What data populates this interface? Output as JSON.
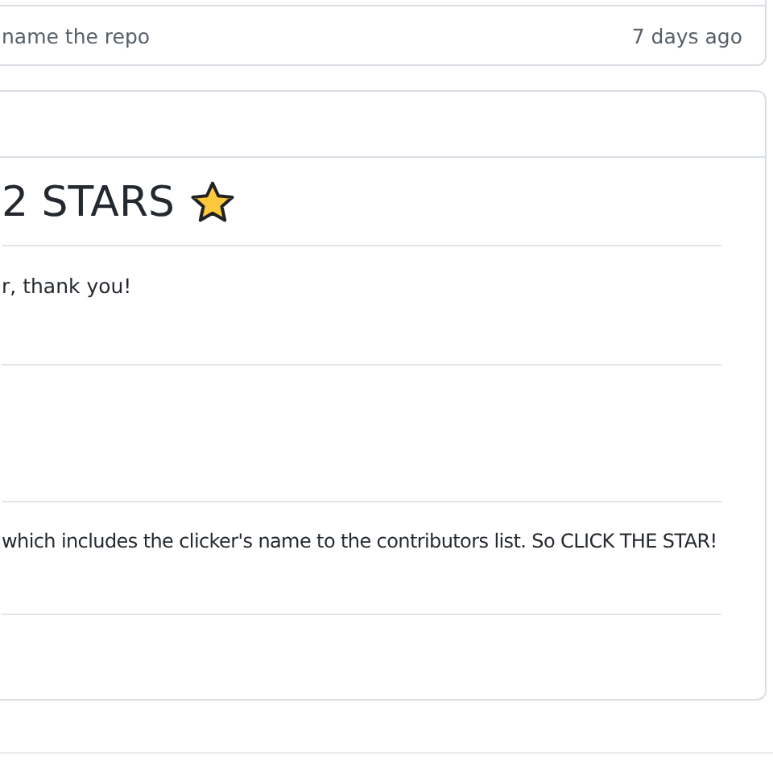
{
  "file_list": {
    "rows": [
      {
        "message": "name the repo",
        "time": "7 days ago"
      }
    ]
  },
  "readme": {
    "heading": "2 STARS",
    "paragraphs": [
      "r, thank you!",
      "which includes the clicker's name to the contributors list. So CLICK THE STAR!"
    ]
  }
}
